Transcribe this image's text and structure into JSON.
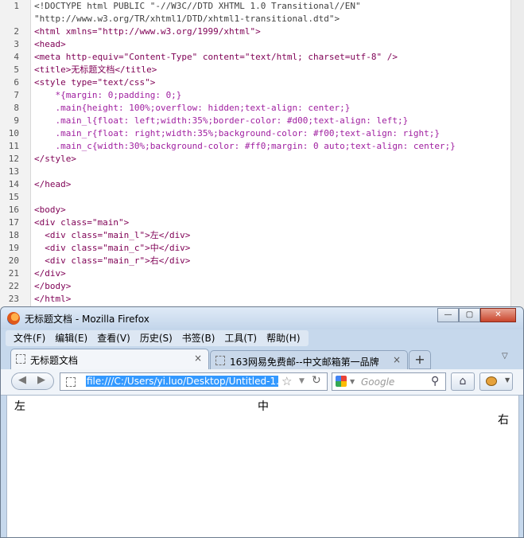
{
  "editor": {
    "lines": [
      {
        "n": "1",
        "text": "<!DOCTYPE html PUBLIC \"-//W3C//DTD XHTML 1.0 Transitional//EN\""
      },
      {
        "n": "",
        "text": "\"http://www.w3.org/TR/xhtml1/DTD/xhtml1-transitional.dtd\">"
      },
      {
        "n": "2",
        "text": "<html xmlns=\"http://www.w3.org/1999/xhtml\">"
      },
      {
        "n": "3",
        "text": "<head>"
      },
      {
        "n": "4",
        "text": "<meta http-equiv=\"Content-Type\" content=\"text/html; charset=utf-8\" />"
      },
      {
        "n": "5",
        "text": "<title>无标题文档</title>"
      },
      {
        "n": "6",
        "text": "<style type=\"text/css\">"
      },
      {
        "n": "7",
        "text": "    *{margin: 0;padding: 0;}"
      },
      {
        "n": "8",
        "text": "    .main{height: 100%;overflow: hidden;text-align: center;}"
      },
      {
        "n": "9",
        "text": "    .main_l{float: left;width:35%;border-color: #d00;text-align: left;}"
      },
      {
        "n": "10",
        "text": "    .main_r{float: right;width:35%;background-color: #f00;text-align: right;}"
      },
      {
        "n": "11",
        "text": "    .main_c{width:30%;background-color: #ff0;margin: 0 auto;text-align: center;}"
      },
      {
        "n": "12",
        "text": "</style>"
      },
      {
        "n": "13",
        "text": ""
      },
      {
        "n": "14",
        "text": "</head>"
      },
      {
        "n": "15",
        "text": ""
      },
      {
        "n": "16",
        "text": "<body>"
      },
      {
        "n": "17",
        "text": "<div class=\"main\">"
      },
      {
        "n": "18",
        "text": "  <div class=\"main_l\">左</div>"
      },
      {
        "n": "19",
        "text": "  <div class=\"main_c\">中</div>"
      },
      {
        "n": "20",
        "text": "  <div class=\"main_r\">右</div>"
      },
      {
        "n": "21",
        "text": "</div>"
      },
      {
        "n": "22",
        "text": "</body>"
      },
      {
        "n": "23",
        "text": "</html>"
      }
    ]
  },
  "window": {
    "title": "无标题文档 - Mozilla Firefox",
    "minimize": "—",
    "maximize": "▢",
    "close": "✕"
  },
  "menu": {
    "items": [
      "文件(F)",
      "编辑(E)",
      "查看(V)",
      "历史(S)",
      "书签(B)",
      "工具(T)",
      "帮助(H)"
    ]
  },
  "tabs": {
    "active_label": "无标题文档",
    "inactive_label": "163网易免费邮--中文邮箱第一品牌",
    "close_glyph": "×",
    "new_tab": "+",
    "list_all": "▽"
  },
  "nav": {
    "back": "◀",
    "forward": "▶",
    "url": "file:///C:/Users/yi.luo/Desktop/Untitled-1.",
    "star": "☆",
    "dropdown": "▼",
    "reload": "↻",
    "search_placeholder": "Google",
    "search_go": "⚲",
    "home": "⌂"
  },
  "page": {
    "left": "左",
    "center": "中",
    "right": "右"
  },
  "colors": {
    "tag": "#7f0055",
    "string": "#2a00ff",
    "selector": "#a020a0",
    "selection": "#3399ff",
    "window_frame": "#c6d8ec"
  }
}
